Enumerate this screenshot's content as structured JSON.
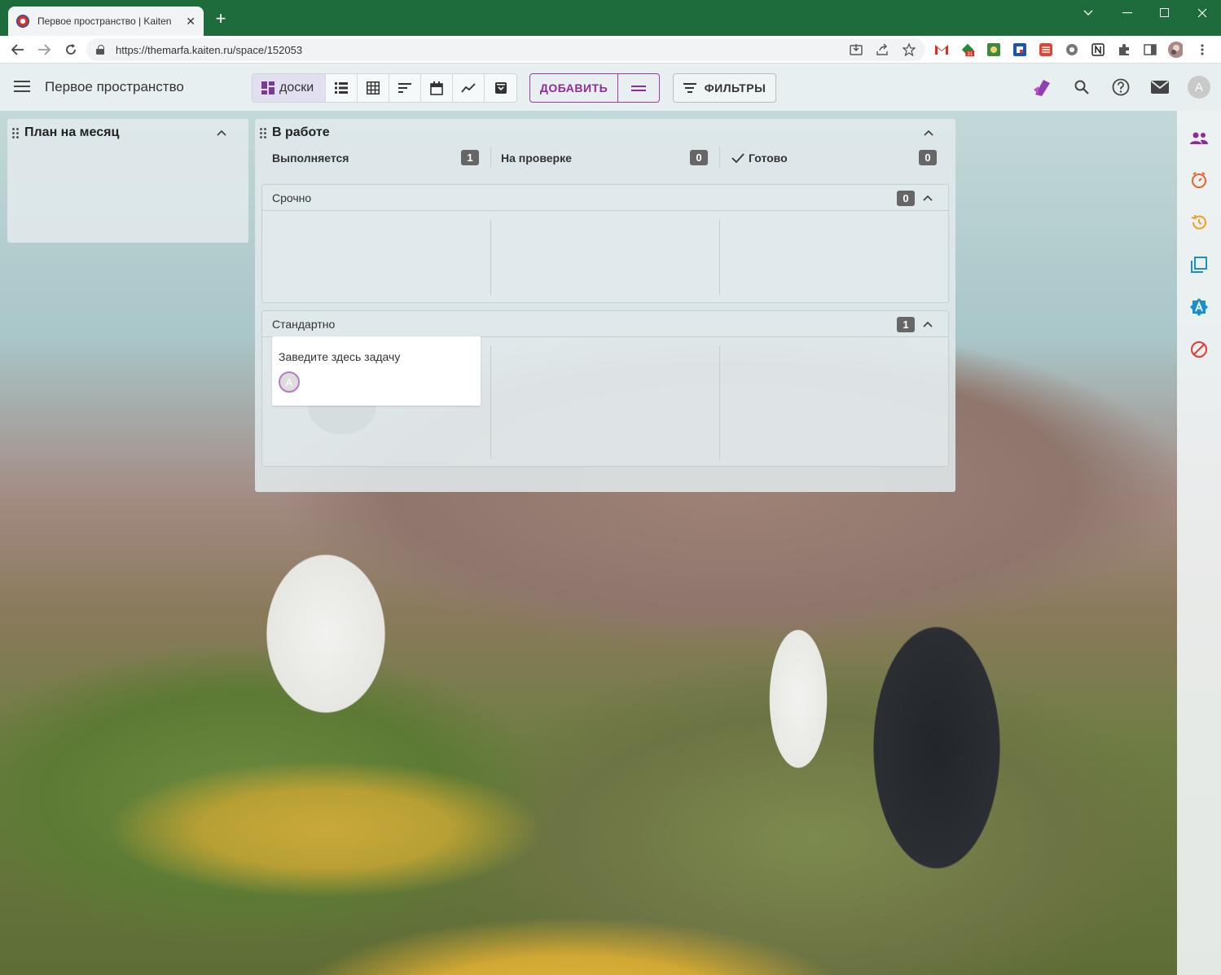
{
  "browser": {
    "tab_title": "Первое пространство | Kaiten",
    "url": "https://themarfa.kaiten.ru/space/152053",
    "tab_close": "✕",
    "new_tab": "+",
    "calendar_badge": "31"
  },
  "header": {
    "space_title": "Первое пространство",
    "view_boards_label": "доски",
    "add_label": "ДОБАВИТЬ",
    "filters_label": "ФИЛЬТРЫ",
    "avatar_initial": "A"
  },
  "boards": [
    {
      "title": "План на месяц"
    },
    {
      "title": "В работе",
      "columns": [
        {
          "name": "Выполняется",
          "count": "1"
        },
        {
          "name": "На проверке",
          "count": "0"
        },
        {
          "name": "Готово",
          "count": "0"
        }
      ],
      "lanes": [
        {
          "name": "Срочно",
          "count": "0"
        },
        {
          "name": "Стандартно",
          "count": "1"
        }
      ],
      "cards": [
        {
          "title": "Заведите здесь задачу",
          "avatar_initial": "A"
        }
      ]
    }
  ],
  "colors": {
    "accent": "#8e2b9c",
    "titlebar": "#1e6b3c",
    "count_badge": "#666666"
  }
}
